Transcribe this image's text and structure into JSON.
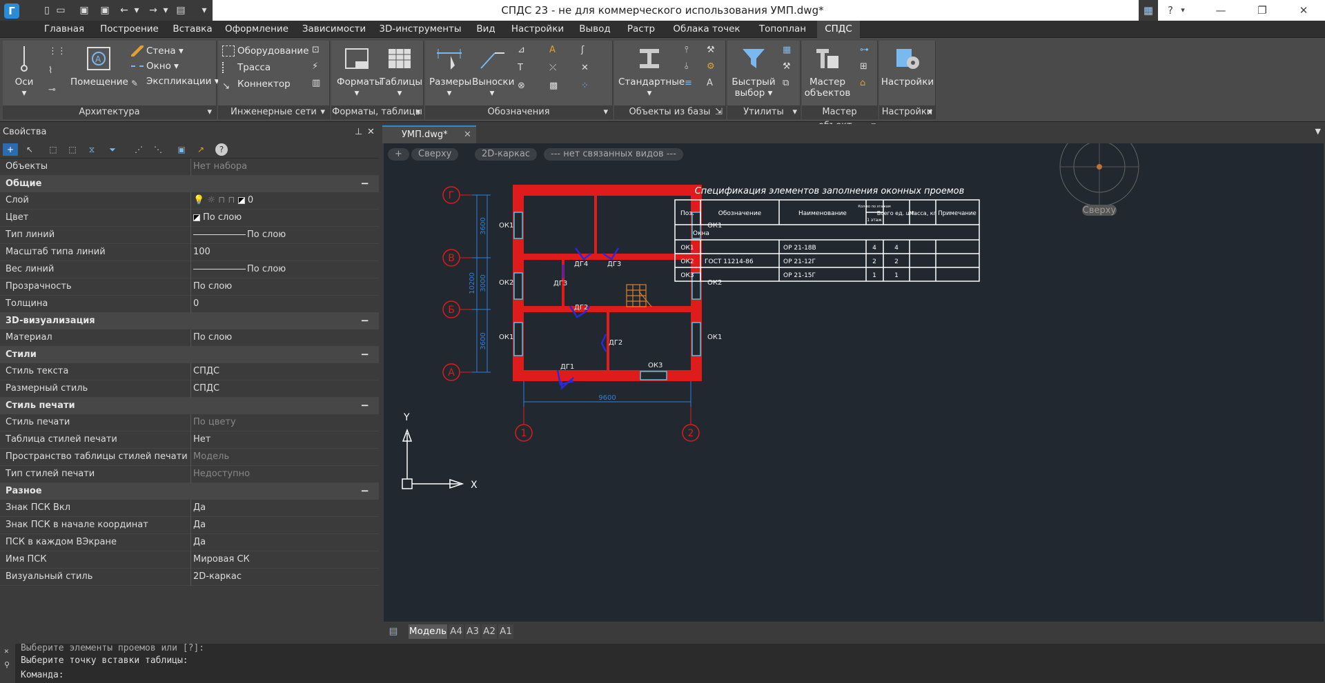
{
  "titlebar": {
    "title": "СПДС 23 - не для коммерческого использования УМП.dwg*",
    "help": "?",
    "logo": "Г"
  },
  "menu": {
    "tabs": [
      "Главная",
      "Построение",
      "Вставка",
      "Оформление",
      "Зависимости",
      "3D-инструменты",
      "Вид",
      "Настройки",
      "Вывод",
      "Растр",
      "Облака точек",
      "Топоплан",
      "СПДС"
    ],
    "active": "СПДС"
  },
  "ribbon": {
    "panels": [
      "Архитектура",
      "Инженерные сети",
      "Форматы, таблицы",
      "Обозначения",
      "Объекты из базы",
      "Утилиты",
      "Мастер объект...",
      "Настройки"
    ],
    "arch": {
      "axes": "Оси",
      "room": "Помещение",
      "wall": "Стена",
      "window": "Окно",
      "explication": "Экспликации"
    },
    "eng": {
      "equipment": "Оборудование",
      "route": "Трасса",
      "connector": "Коннектор"
    },
    "formats": {
      "formats": "Форматы",
      "tables": "Таблицы"
    },
    "marks": {
      "dims": "Размеры",
      "leaders": "Выноски"
    },
    "base": {
      "standard": "Стандартные"
    },
    "utils": {
      "quick1": "Быстрый",
      "quick2": "выбор"
    },
    "master": {
      "l1": "Мастер",
      "l2": "объектов"
    },
    "settings": {
      "label": "Настройки"
    }
  },
  "props": {
    "title": "Свойства",
    "rows": [
      {
        "type": "row",
        "k": "Объекты",
        "v": "Нет набора",
        "dim": true
      },
      {
        "type": "sect",
        "k": "Общие"
      },
      {
        "type": "row",
        "k": "Слой",
        "v": "0",
        "icon": "layer"
      },
      {
        "type": "row",
        "k": "Цвет",
        "v": "По слою",
        "icon": "color"
      },
      {
        "type": "row",
        "k": "Тип линий",
        "v": "По слою",
        "icon": "line"
      },
      {
        "type": "row",
        "k": "Масштаб типа линий",
        "v": "100"
      },
      {
        "type": "row",
        "k": "Вес линий",
        "v": "По слою",
        "icon": "line"
      },
      {
        "type": "row",
        "k": "Прозрачность",
        "v": "По слою"
      },
      {
        "type": "row",
        "k": "Толщина",
        "v": "0"
      },
      {
        "type": "sect",
        "k": "3D-визуализация"
      },
      {
        "type": "row",
        "k": "Материал",
        "v": "По слою"
      },
      {
        "type": "sect",
        "k": "Стили"
      },
      {
        "type": "row",
        "k": "Стиль текста",
        "v": "СПДС"
      },
      {
        "type": "row",
        "k": "Размерный стиль",
        "v": "СПДС"
      },
      {
        "type": "sect",
        "k": "Стиль печати"
      },
      {
        "type": "row",
        "k": "Стиль печати",
        "v": "По цвету",
        "dim": true
      },
      {
        "type": "row",
        "k": "Таблица стилей печати",
        "v": "Нет"
      },
      {
        "type": "row",
        "k": "Пространство таблицы стилей печати",
        "v": "Модель",
        "dim": true
      },
      {
        "type": "row",
        "k": "Тип стилей печати",
        "v": "Недоступно",
        "dim": true
      },
      {
        "type": "sect",
        "k": "Разное"
      },
      {
        "type": "row",
        "k": "Знак ПСК Вкл",
        "v": "Да"
      },
      {
        "type": "row",
        "k": "Знак ПСК в начале координат",
        "v": "Да"
      },
      {
        "type": "row",
        "k": "ПСК в каждом ВЭкране",
        "v": "Да"
      },
      {
        "type": "row",
        "k": "Имя ПСК",
        "v": "Мировая СК"
      },
      {
        "type": "row",
        "k": "Визуальный стиль",
        "v": "2D-каркас"
      }
    ]
  },
  "doc": {
    "tab": "УМП.dwg*",
    "close": "✕"
  },
  "viewport": {
    "plus": "+",
    "view": "Сверху",
    "style": "2D-каркас",
    "linked": "--- нет связанных видов ---",
    "cube": "Сверху"
  },
  "plan": {
    "axes_letters": [
      "Г",
      "В",
      "Б",
      "А"
    ],
    "axes_numbers": [
      "1",
      "2"
    ],
    "dims": {
      "d1": "3600",
      "d2": "3000",
      "d3": "3600",
      "total_v": "10200",
      "total_h": "9600"
    },
    "labels": {
      "ok1": "ОК1",
      "ok2": "ОК2",
      "ok3": "ОК3",
      "dg1": "ДГ1",
      "dg2": "ДГ2",
      "dg3": "ДГ3",
      "dg4": "ДГ4"
    }
  },
  "spec": {
    "title": "Спецификация элементов заполнения оконных проемов",
    "headers": [
      "Поз.",
      "Обозначение",
      "Наименование",
      "Кол-во по этажам",
      "Всего ед. шт.",
      "Масса, кг",
      "Примечание"
    ],
    "floor": "1 этаж",
    "group": "Окна",
    "rows": [
      {
        "pos": "ОК1",
        "des": "ГОСТ 11214-86",
        "name": "ОР 21-18В",
        "q": "4",
        "t": "4"
      },
      {
        "pos": "ОК2",
        "des": "",
        "name": "ОР 21-12Г",
        "q": "2",
        "t": "2"
      },
      {
        "pos": "ОК3",
        "des": "",
        "name": "ОР 21-15Г",
        "q": "1",
        "t": "1"
      }
    ]
  },
  "ucs": {
    "x": "X",
    "y": "Y"
  },
  "layouts": {
    "model": "Модель",
    "a4": "А4",
    "a3": "А3",
    "a2": "А2",
    "a1": "А1"
  },
  "cmd": {
    "l1": "Выберите элементы проемов или [?]:",
    "l2": "Выберите точку вставки таблицы:",
    "l3": "Команда:"
  },
  "colors": {
    "accent": "#2b8cd6",
    "wall": "#e01b1b",
    "axis": "#e01b1b",
    "dim": "#2f7fe0",
    "door": "#2a2ad8",
    "window": "#4fc6e8",
    "stair": "#e0802a"
  }
}
